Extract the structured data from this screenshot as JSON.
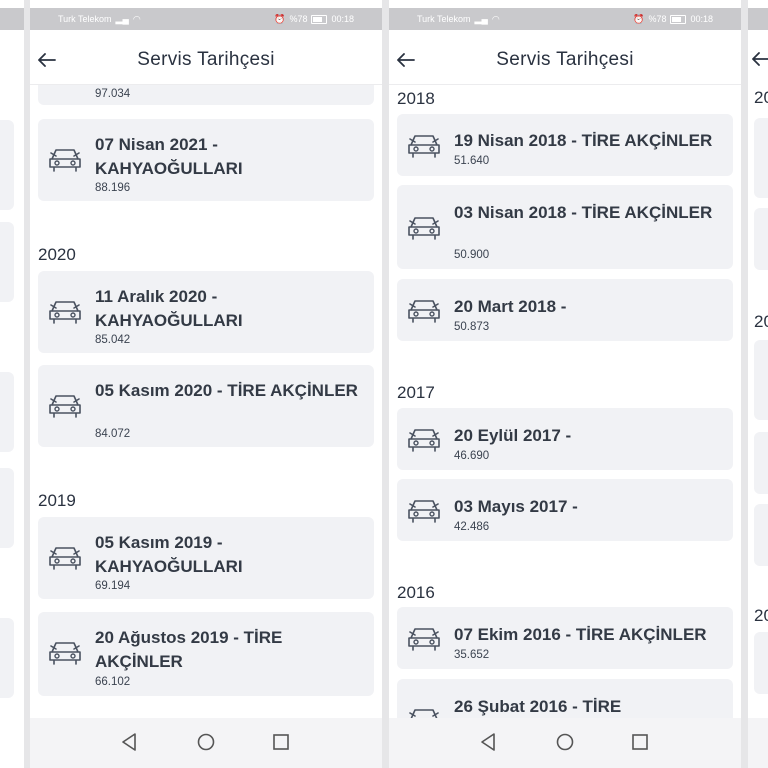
{
  "screen1": {
    "status": {
      "carrier": "Turk Telekom",
      "battery": "%78",
      "time": "00:18"
    },
    "header": {
      "title": "Servis Tarihçesi"
    },
    "partial_km": "97.034",
    "years": [
      {
        "label": "",
        "cards": [
          {
            "title": "07 Nisan 2021 - KAHYAOĞULLARI",
            "km": "88.196"
          }
        ]
      },
      {
        "label": "2020",
        "cards": [
          {
            "title": "11 Aralık 2020 - KAHYAOĞULLARI",
            "km": "85.042"
          },
          {
            "title": "05 Kasım 2020 - TİRE AKÇİNLER",
            "km": "84.072"
          }
        ]
      },
      {
        "label": "2019",
        "cards": [
          {
            "title": "05 Kasım 2019 - KAHYAOĞULLARI",
            "km": "69.194"
          },
          {
            "title": "20 Ağustos 2019 - TİRE AKÇİNLER",
            "km": "66.102"
          }
        ]
      }
    ]
  },
  "screen2": {
    "status": {
      "carrier": "Turk Telekom",
      "battery": "%78",
      "time": "00:18"
    },
    "header": {
      "title": "Servis Tarihçesi"
    },
    "years": [
      {
        "label": "2018",
        "cards": [
          {
            "title": "19 Nisan 2018 - TİRE AKÇİNLER",
            "km": "51.640"
          },
          {
            "title": "03 Nisan 2018 - TİRE AKÇİNLER",
            "km": "50.900"
          },
          {
            "title": "20 Mart 2018 -",
            "km": "50.873"
          }
        ]
      },
      {
        "label": "2017",
        "cards": [
          {
            "title": "20 Eylül 2017 -",
            "km": "46.690"
          },
          {
            "title": "03 Mayıs 2017 -",
            "km": "42.486"
          }
        ]
      },
      {
        "label": "2016",
        "cards": [
          {
            "title": "07 Ekim 2016 - TİRE AKÇİNLER",
            "km": "35.652"
          },
          {
            "title": "26 Şubat 2016 - TİRE",
            "km": ""
          }
        ]
      }
    ]
  },
  "edge_right": {
    "year_a": "20",
    "year_b": "20",
    "year_c": "20"
  },
  "icons": {
    "back": "arrow-left-icon",
    "car": "car-service-icon",
    "nav_back": "triangle-back-icon",
    "nav_home": "circle-home-icon",
    "nav_recent": "square-recent-icon"
  }
}
